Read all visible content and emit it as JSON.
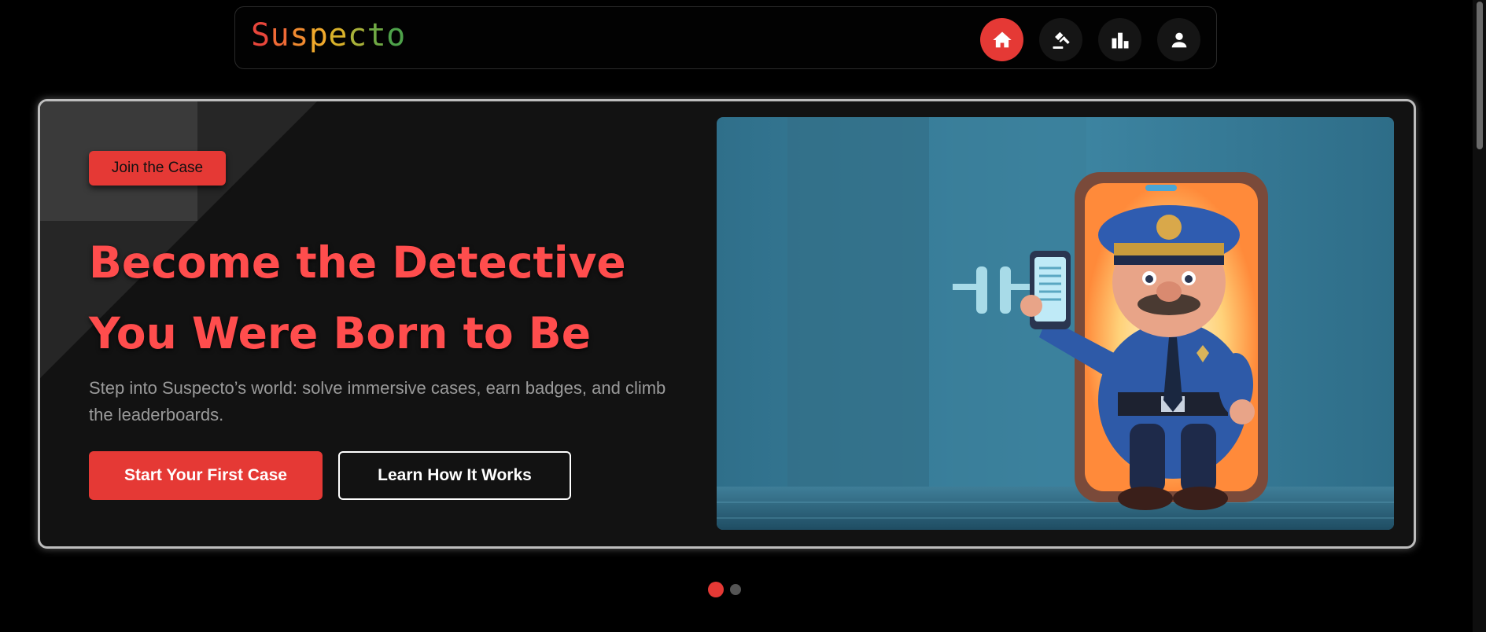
{
  "brand": {
    "name": "Suspecto",
    "letters": [
      {
        "char": "S",
        "color": "#e8463b"
      },
      {
        "char": "u",
        "color": "#ef6a36"
      },
      {
        "char": "s",
        "color": "#f08a30"
      },
      {
        "char": "p",
        "color": "#f0a92c"
      },
      {
        "char": "e",
        "color": "#d8b12a"
      },
      {
        "char": "c",
        "color": "#a9b23a"
      },
      {
        "char": "t",
        "color": "#6fa844"
      },
      {
        "char": "o",
        "color": "#4ea24a"
      }
    ]
  },
  "nav": {
    "items": [
      {
        "icon": "home-icon",
        "active": true
      },
      {
        "icon": "gavel-icon",
        "active": false
      },
      {
        "icon": "bar-chart-icon",
        "active": false
      },
      {
        "icon": "user-icon",
        "active": false
      }
    ]
  },
  "hero": {
    "badge_label": "Join the Case",
    "headline_line1": "Become the Detective",
    "headline_line2": "You Were Born to Be",
    "subtitle": "Step into Suspecto’s world: solve immersive cases, earn badges, and climb the leaderboards.",
    "primary_cta": "Start Your First Case",
    "secondary_cta": "Learn How It Works",
    "image": "cartoon police officer stepping out of a smartphone holding a phone"
  },
  "carousel": {
    "slides": 2,
    "active_index": 0
  },
  "colors": {
    "accent": "#e53935",
    "headline": "#ff4d4d",
    "background": "#000000",
    "card": "#121212"
  }
}
